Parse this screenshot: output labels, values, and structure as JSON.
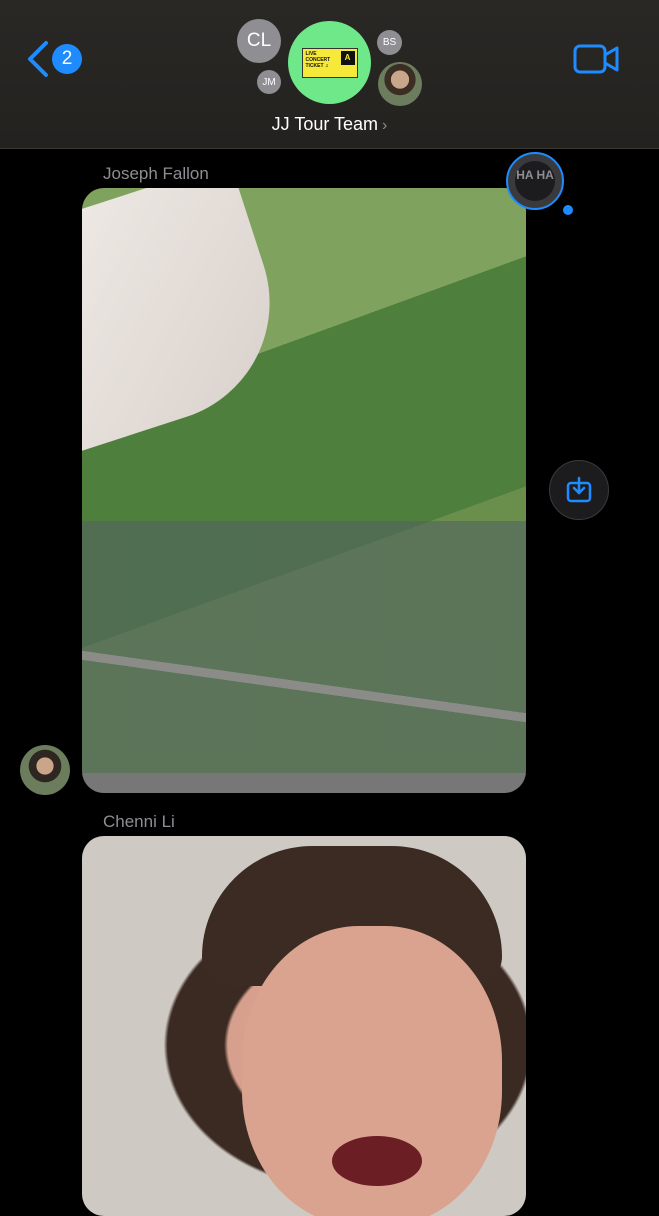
{
  "header": {
    "back_count": "2",
    "chat_title": "JJ Tour Team",
    "title_chevron": "›",
    "avatars": {
      "cl": "CL",
      "jm": "JM",
      "bs": "BS"
    },
    "group_icon": {
      "ticket_line1": "LIVE",
      "ticket_line2": "CONCERT",
      "ticket_line3": "TICKET ♫",
      "zone_label": "ZONE",
      "zone_value": "A"
    }
  },
  "messages": [
    {
      "sender": "Joseph Fallon",
      "type": "photo",
      "reaction": "HA HA"
    },
    {
      "sender": "Chenni Li",
      "type": "photo"
    }
  ],
  "colors": {
    "accent": "#1e8bff",
    "background": "#000000",
    "header_bg": "#2a2825",
    "muted_text": "#8e8e93"
  },
  "icons": [
    "back-chevron-icon",
    "video-call-icon",
    "save-download-icon",
    "haha-reaction-icon"
  ]
}
